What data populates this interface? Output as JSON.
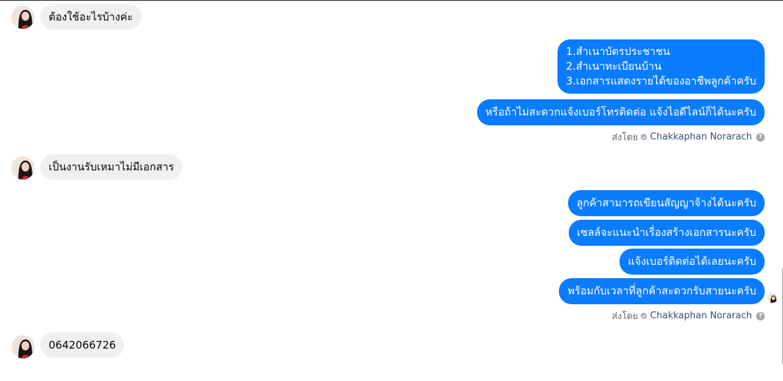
{
  "messages": {
    "m1": "ต้องใช้อะไรบ้างค่ะ",
    "m2_lines": [
      "1.สำเนาบัตรประชาชน",
      "2.สำเนาทะเบียนบ้าน",
      "3.เอกสารแสดงรายได้ของอาชีพลูกค้าครับ"
    ],
    "m3": "หรือถ้าไม่สะดวกแจ้งเบอร์โทรติดต่อ แจ้งไอดีไลน์ก็ได้นะครับ",
    "m4": "เป็นงานรับเหมาไม่มีเอกสาร",
    "m5": "ลูกค้าสามารถเขียนสัญญาจ้างได้นะครับ",
    "m6": "เซลล์จะแนะนำเรื่องสร้างเอกสารนะครับ",
    "m7": "แจ้งเบอร์ติดต่อได้เลยนะครับ",
    "m8": "พร้อมกับเวลาที่ลูกค้าสะดวกรับสายนะครับ",
    "m9": "0642066726"
  },
  "sent_by": {
    "label": "ส่งโดย",
    "name": "Chakkaphan Norarach"
  },
  "icons": {
    "verified": "check-circle-icon",
    "help": "help-icon",
    "help_glyph": "?"
  },
  "colors": {
    "outgoing_bubble": "#0a7cff",
    "incoming_bubble": "#f0f0f0",
    "sender_name": "#3b4a7a"
  }
}
